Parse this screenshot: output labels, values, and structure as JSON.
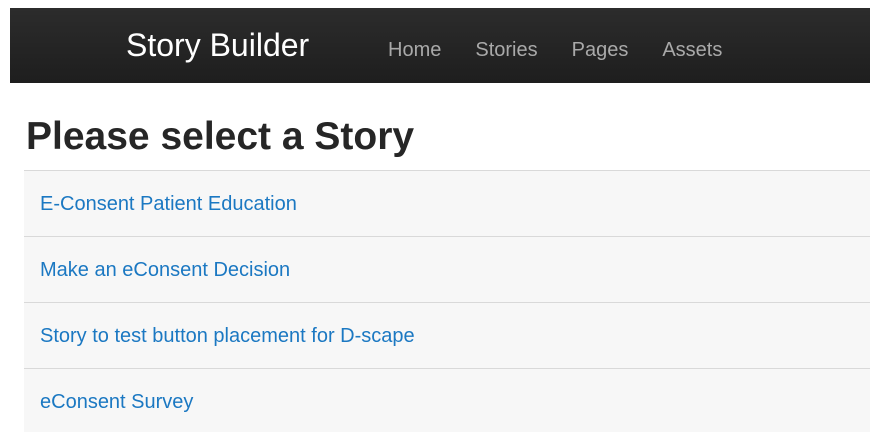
{
  "navbar": {
    "brand": "Story Builder",
    "links": [
      "Home",
      "Stories",
      "Pages",
      "Assets"
    ]
  },
  "main": {
    "title": "Please select a Story",
    "stories": [
      "E-Consent Patient Education",
      "Make an eConsent Decision",
      "Story to test button placement for D-scape",
      "eConsent Survey"
    ]
  },
  "colors": {
    "navbar_background": "#222222",
    "link": "#1b78c2",
    "nav_link": "#a9a9a9"
  }
}
